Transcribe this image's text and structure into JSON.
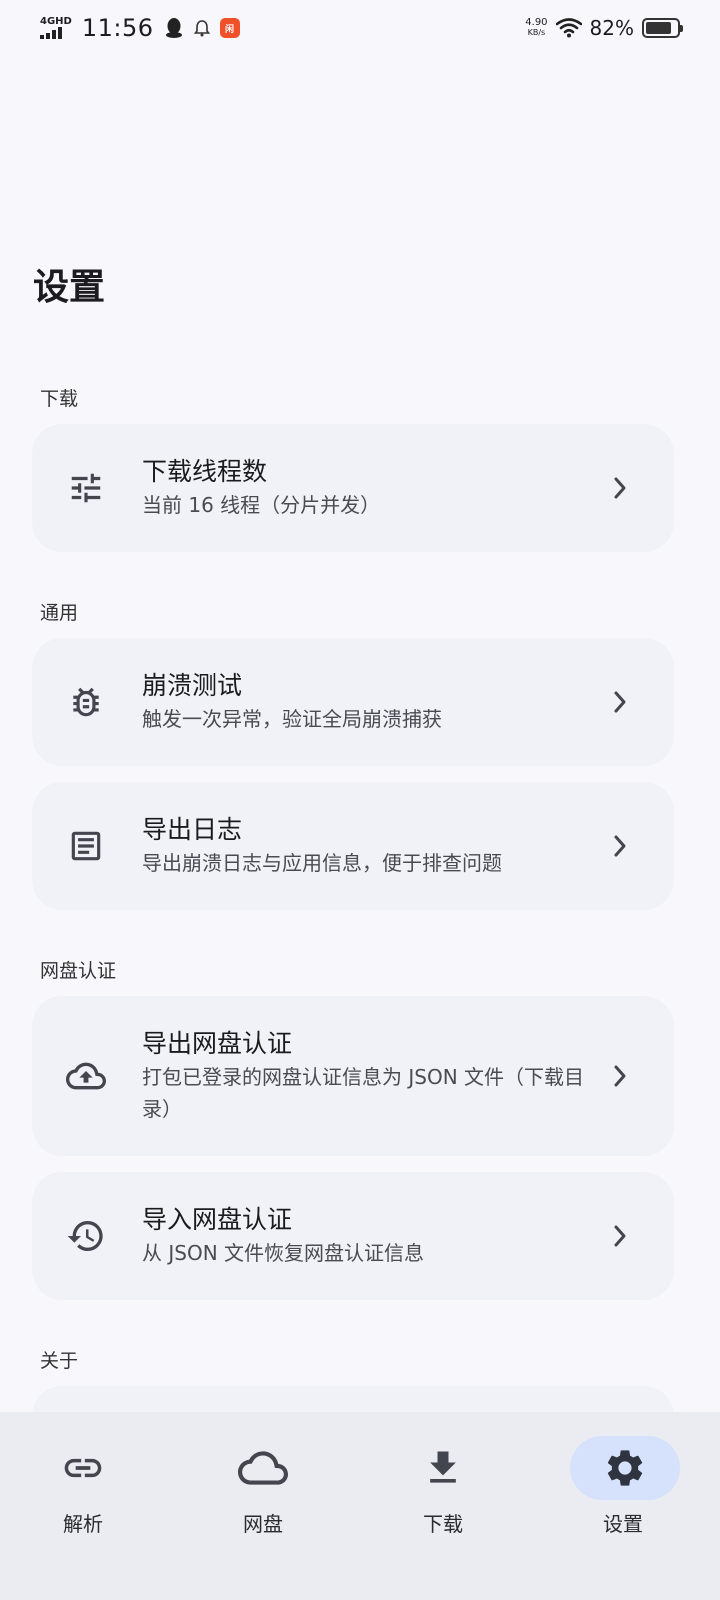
{
  "status_bar": {
    "network": "4GHD",
    "time": "11:56",
    "app_badge": "闲",
    "speed_value": "4.90",
    "speed_unit": "KB/s",
    "battery_percent": "82%",
    "battery_level": 0.82
  },
  "page": {
    "title": "设置"
  },
  "sections": [
    {
      "label": "下载",
      "items": [
        {
          "icon": "tune-icon",
          "title": "下载线程数",
          "subtitle": "当前 16 线程（分片并发）"
        }
      ]
    },
    {
      "label": "通用",
      "items": [
        {
          "icon": "bug-icon",
          "title": "崩溃测试",
          "subtitle": "触发一次异常，验证全局崩溃捕获"
        },
        {
          "icon": "article-icon",
          "title": "导出日志",
          "subtitle": "导出崩溃日志与应用信息，便于排查问题"
        }
      ]
    },
    {
      "label": "网盘认证",
      "items": [
        {
          "icon": "cloud-upload-icon",
          "title": "导出网盘认证",
          "subtitle": "打包已登录的网盘认证信息为 JSON 文件（下载目录）"
        },
        {
          "icon": "history-icon",
          "title": "导入网盘认证",
          "subtitle": "从 JSON 文件恢复网盘认证信息"
        }
      ]
    },
    {
      "label": "关于",
      "items": []
    }
  ],
  "bottom_nav": [
    {
      "icon": "link-icon",
      "label": "解析",
      "active": false
    },
    {
      "icon": "cloud-icon",
      "label": "网盘",
      "active": false
    },
    {
      "icon": "download-icon",
      "label": "下载",
      "active": false
    },
    {
      "icon": "gear-icon",
      "label": "设置",
      "active": true
    }
  ],
  "colors": {
    "background": "#f8f8fc",
    "card": "#f1f2f7",
    "nav_background": "#ebecf1",
    "active_pill": "#d6e2fb",
    "icon": "#44464f"
  }
}
